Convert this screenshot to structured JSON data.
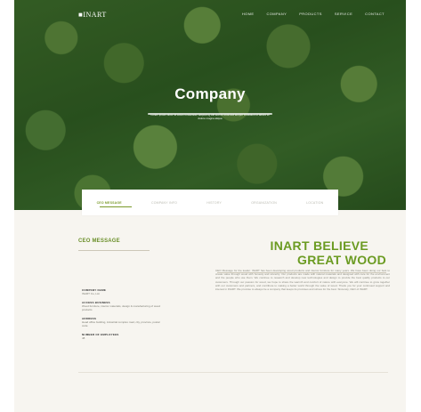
{
  "brand": {
    "logo": "■INART"
  },
  "nav": {
    "items": [
      "HOME",
      "COMPANY",
      "PRODUCTS",
      "SERVICE",
      "CONTACT"
    ]
  },
  "hero": {
    "title": "Company",
    "subtitle": "Lorem ipsum dolor sit amet consectetur adipiscing elit sed do eiusmod tempor incididunt ut labore et dolore magna aliqua"
  },
  "tabs": {
    "items": [
      {
        "label": "CEO MESSAGE",
        "active": true
      },
      {
        "label": "COMPANY INFO",
        "active": false
      },
      {
        "label": "HISTORY",
        "active": false
      },
      {
        "label": "ORGANIZATION",
        "active": false
      },
      {
        "label": "LOCATION",
        "active": false
      }
    ]
  },
  "ceo": {
    "section_title": "CEO MESSAGE",
    "headline_line1": "INART BELIEVE",
    "headline_line2": "GREAT WOOD",
    "body": "CEO Message for the leader. INART has been developing wood products and interior furniture for many years. We have been doing our best to create value through wood with honesty and sincerity. Our products are made with natural materials and designed with care for the environment and the people who use them. We continue to research and develop new technologies and design to provide the best quality products to our customers. Through our passion for wood, we hope to share the warmth and comfort of nature with everyone. We will continue to grow together with our customers and partners, and contribute to making a better world through the value of wood. Thank you for your continued support and interest in INART. We promise to always be a company that keeps its promises and strives for the best. Sincerely, CEO of INART."
  },
  "company_info": [
    {
      "label": "COMPANY NAME",
      "value": "INART Co.,Ltd."
    },
    {
      "label": "ACCESS BUSINESS",
      "value": "Wood furniture, interior materials, design & manufacturing of wood products"
    },
    {
      "label": "ADDRESS",
      "value": "Head office building, industrial complex road, city, province, postal code"
    },
    {
      "label": "NUMBER OF EMPLOYEES",
      "value": "48"
    }
  ]
}
